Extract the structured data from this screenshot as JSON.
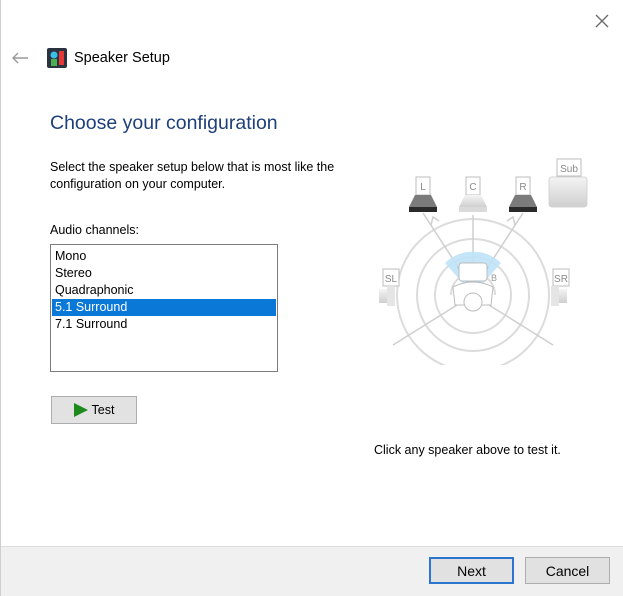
{
  "window": {
    "title": "Speaker Setup"
  },
  "main": {
    "heading": "Choose your configuration",
    "description": "Select the speaker setup below that is most like the configuration on your computer.",
    "channels_label": "Audio channels:",
    "channels": [
      {
        "label": "Mono",
        "selected": false
      },
      {
        "label": "Stereo",
        "selected": false
      },
      {
        "label": "Quadraphonic",
        "selected": false
      },
      {
        "label": "5.1 Surround",
        "selected": true
      },
      {
        "label": "7.1 Surround",
        "selected": false
      }
    ],
    "test_label": "Test",
    "hint": "Click any speaker above to test it."
  },
  "diagram": {
    "speakers": {
      "left": "L",
      "center": "C",
      "right": "R",
      "sub": "Sub",
      "surround_left": "SL",
      "surround_right": "SR"
    }
  },
  "footer": {
    "next_label": "Next",
    "cancel_label": "Cancel"
  },
  "colors": {
    "heading": "#1e3f7a",
    "selection": "#0a78d7",
    "play": "#1c8b1c",
    "default_button_border": "#2d76cf"
  },
  "icons": {
    "close": "close-icon",
    "back": "back-arrow-icon",
    "app": "speaker-setup-icon",
    "test": "play-icon"
  }
}
